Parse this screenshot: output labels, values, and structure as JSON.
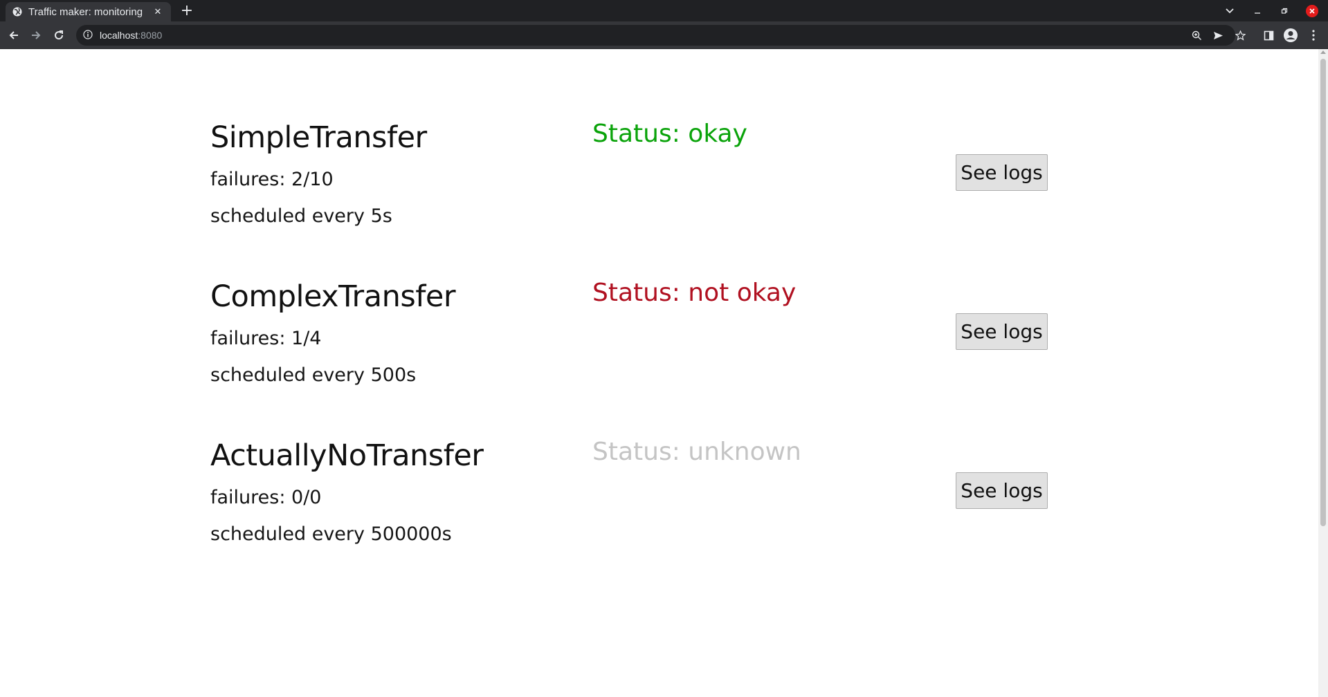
{
  "browser": {
    "tab_title": "Traffic maker: monitoring",
    "tab_close_glyph": "✕",
    "new_tab_glyph": "+",
    "url_host": "localhost",
    "url_port": ":8080"
  },
  "colors": {
    "status_okay": "#0aa30a",
    "status_not_okay": "#b01020",
    "status_unknown": "#c4c4c4"
  },
  "jobs": [
    {
      "name": "SimpleTransfer",
      "failures": "failures: 2/10",
      "schedule": "scheduled every 5s",
      "status": "Status: okay",
      "status_kind": "okay",
      "button_label": "See logs"
    },
    {
      "name": "ComplexTransfer",
      "failures": "failures: 1/4",
      "schedule": "scheduled every 500s",
      "status": "Status: not okay",
      "status_kind": "not_okay",
      "button_label": "See logs"
    },
    {
      "name": "ActuallyNoTransfer",
      "failures": "failures: 0/0",
      "schedule": "scheduled every 500000s",
      "status": "Status: unknown",
      "status_kind": "unknown",
      "button_label": "See logs"
    }
  ]
}
